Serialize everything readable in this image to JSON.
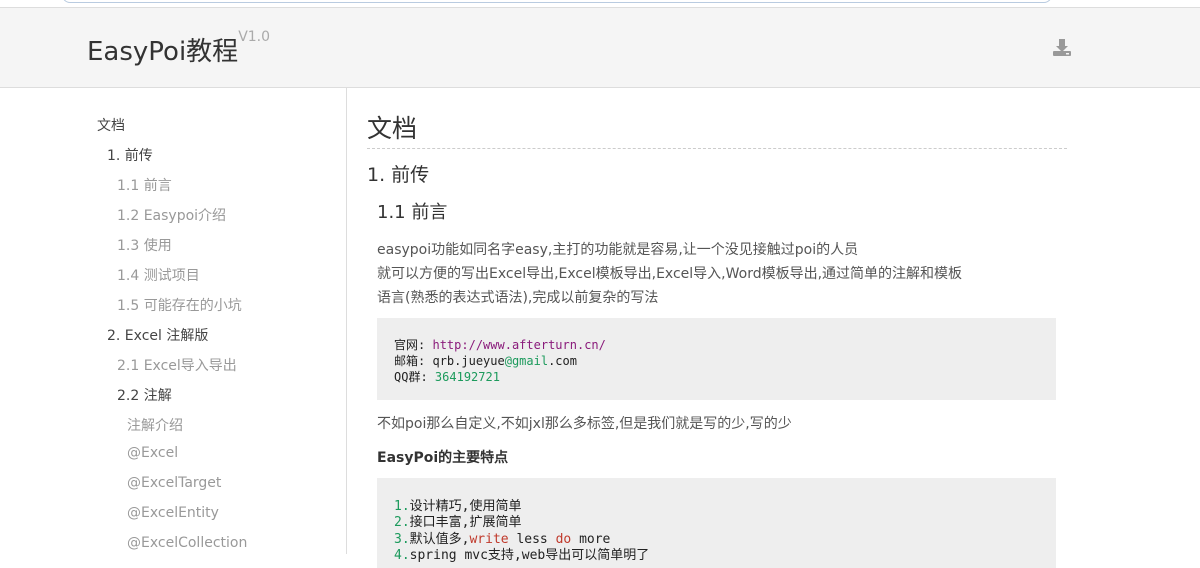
{
  "header": {
    "title": "EasyPoi教程",
    "version": "V1.0",
    "download_icon": "download-icon"
  },
  "sidebar": {
    "items": [
      {
        "label": "文档",
        "level": 0
      },
      {
        "label": "1. 前传",
        "level": 1
      },
      {
        "label": "1.1 前言",
        "level": 2
      },
      {
        "label": "1.2 Easypoi介绍",
        "level": 2
      },
      {
        "label": "1.3 使用",
        "level": 2
      },
      {
        "label": "1.4 测试项目",
        "level": 2
      },
      {
        "label": "1.5 可能存在的小坑",
        "level": 2
      },
      {
        "label": "2. Excel 注解版",
        "level": 1
      },
      {
        "label": "2.1 Excel导入导出",
        "level": 2
      },
      {
        "label": "2.2 注解",
        "level": 2
      },
      {
        "label": "注解介绍",
        "level": 3
      },
      {
        "label": "@Excel",
        "level": 3
      },
      {
        "label": "@ExcelTarget",
        "level": 3
      },
      {
        "label": "@ExcelEntity",
        "level": 3
      },
      {
        "label": "@ExcelCollection",
        "level": 3
      }
    ]
  },
  "content": {
    "h1": "文档",
    "h2": "1. 前传",
    "h3": "1.1 前言",
    "intro_lines": [
      " easypoi功能如同名字easy,主打的功能就是容易,让一个没见接触过poi的人员",
      "就可以方便的写出Excel导出,Excel模板导出,Excel导入,Word模板导出,通过简单的注解和模板",
      "语言(熟悉的表达式语法),完成以前复杂的写法"
    ],
    "contact": {
      "site_label": "官网:",
      "site_url_scheme": "http:",
      "site_url_rest": "//www.afterturn.cn/",
      "mail_label": "邮箱:",
      "mail_user": "qrb.jueyue",
      "mail_at_domain": "@gmail",
      "mail_tld": ".com",
      "qq_label": "QQ群:",
      "qq_number": "364192721"
    },
    "tagline": "不如poi那么自定义,不如jxl那么多标签,但是我们就是写的少,写的少",
    "features_title": "EasyPoi的主要特点",
    "features": [
      {
        "num": "1.",
        "text": "设计精巧,使用简单"
      },
      {
        "num": "2.",
        "text": "接口丰富,扩展简单"
      },
      {
        "num": "3.",
        "text_a": "默认值多,",
        "kw1": "write",
        "text_b": " less ",
        "kw2": "do",
        "text_c": " more"
      },
      {
        "num": "4.",
        "text": "spring mvc支持,web导出可以简单明了"
      }
    ]
  }
}
